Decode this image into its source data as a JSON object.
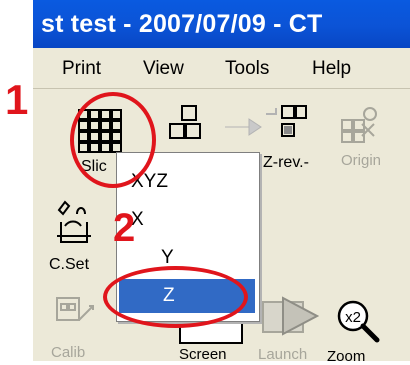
{
  "window": {
    "title": "st  test - 2007/07/09 - CT"
  },
  "menubar": {
    "items": [
      "Print",
      "View",
      "Tools",
      "Help"
    ]
  },
  "toolbar": {
    "slice_label": "Slic",
    "zrev_label": "Z-rev.-",
    "origin_label": "Origin",
    "cset_label": "C.Set",
    "bottom_labels": [
      "Calib",
      "Screen",
      "Launch",
      "Zoom"
    ]
  },
  "popup_menu": {
    "items": [
      "XYZ",
      "X",
      "Y",
      "Z"
    ],
    "selected": "Z"
  },
  "annotations": {
    "step1": "1",
    "step2": "2"
  },
  "colors": {
    "titlebar": "#0b53d6",
    "highlight": "#316ac5",
    "annotation": "#e0151c",
    "window_bg": "#ece9d8"
  }
}
